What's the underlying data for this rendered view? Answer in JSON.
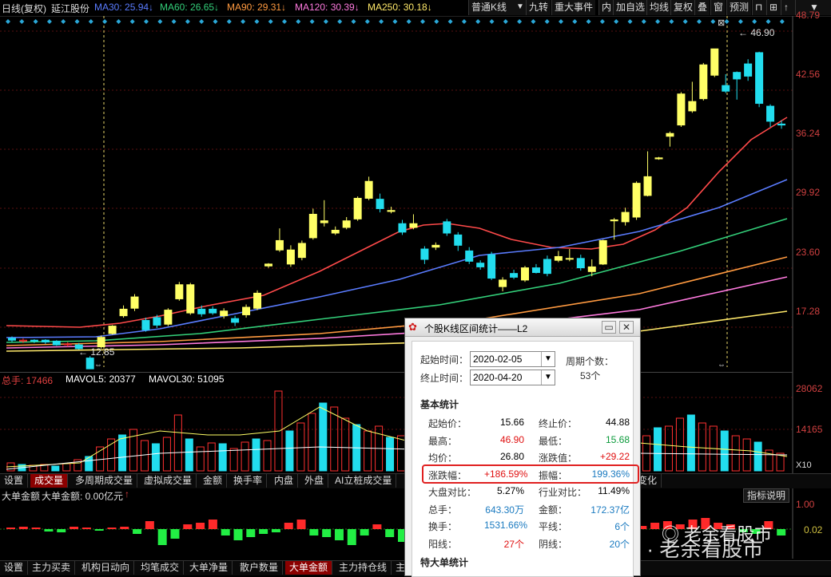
{
  "topbar": {
    "chart_title": "日线(复权)",
    "stock_name": "延江股份",
    "ma": [
      {
        "label": "MA30: 25.94",
        "color": "#5a7cff"
      },
      {
        "label": "MA60: 26.65",
        "color": "#33d07a"
      },
      {
        "label": "MA90: 29.31",
        "color": "#ff9a40"
      },
      {
        "label": "MA120: 30.39",
        "color": "#ff7adf"
      },
      {
        "label": "MA250: 30.18",
        "color": "#ffe96a"
      }
    ],
    "buttons": [
      "普通K线",
      "九转",
      "重大事件",
      "内",
      "加自选",
      "均线",
      "复权",
      "叠",
      "窗",
      "预测"
    ]
  },
  "price_axis": [
    "48.79",
    "42.56",
    "36.24",
    "29.92",
    "23.60",
    "17.28"
  ],
  "volume_axis": [
    "28062",
    "14165",
    "X10"
  ],
  "indicator_axis": [
    "1.00",
    "0.02"
  ],
  "annotations": {
    "high": "46.90",
    "low": "12.85"
  },
  "volume_bar": {
    "total": "总手: 17466",
    "mavol5": "MAVOL5: 20377",
    "mavol30": "MAVOL30: 51095"
  },
  "volume_tabs": [
    "设置",
    "成交量",
    "多周期成交量",
    "虚拟成交量",
    "金额",
    "换手率",
    "内盘",
    "外盘",
    "AI立桩成交量",
    "变化"
  ],
  "indicator_bar": {
    "title": "大单金额",
    "value": "大单金额: 0.00亿元",
    "right": "指标说明"
  },
  "bottom_tabs": [
    "设置",
    "主力买卖",
    "机构日动向",
    "均笔成交",
    "大单净量",
    "散户数量",
    "大单金额",
    "主力持仓线",
    "主"
  ],
  "dialog": {
    "title": "个股K线区间统计——L2",
    "start_label": "起始时间：",
    "start_value": "2020-02-05",
    "end_label": "终止时间：",
    "end_value": "2020-04-20",
    "period_label": "周期个数：",
    "period_value": "53个",
    "section_basic": "基本统计",
    "section_big": "特大单统计",
    "rows": [
      [
        "起始价：",
        "15.66",
        "终止价：",
        "44.88"
      ],
      [
        "最高：",
        "46.90",
        "最低：",
        "15.68"
      ],
      [
        "均价：",
        "26.80",
        "涨跌值：",
        "+29.22"
      ],
      [
        "涨跌幅：",
        "+186.59%",
        "振幅：",
        "199.36%"
      ],
      [
        "大盘对比：",
        "5.27%",
        "行业对比：",
        "11.49%"
      ],
      [
        "总手：",
        "643.30万",
        "金额：",
        "172.37亿"
      ],
      [
        "换手：",
        "1531.66%",
        "平线：",
        "6个"
      ],
      [
        "阳线：",
        "27个",
        "阴线：",
        "20个"
      ]
    ]
  },
  "watermark": "雪球 · 老余看股市",
  "watermark2": "老余看股市"
}
